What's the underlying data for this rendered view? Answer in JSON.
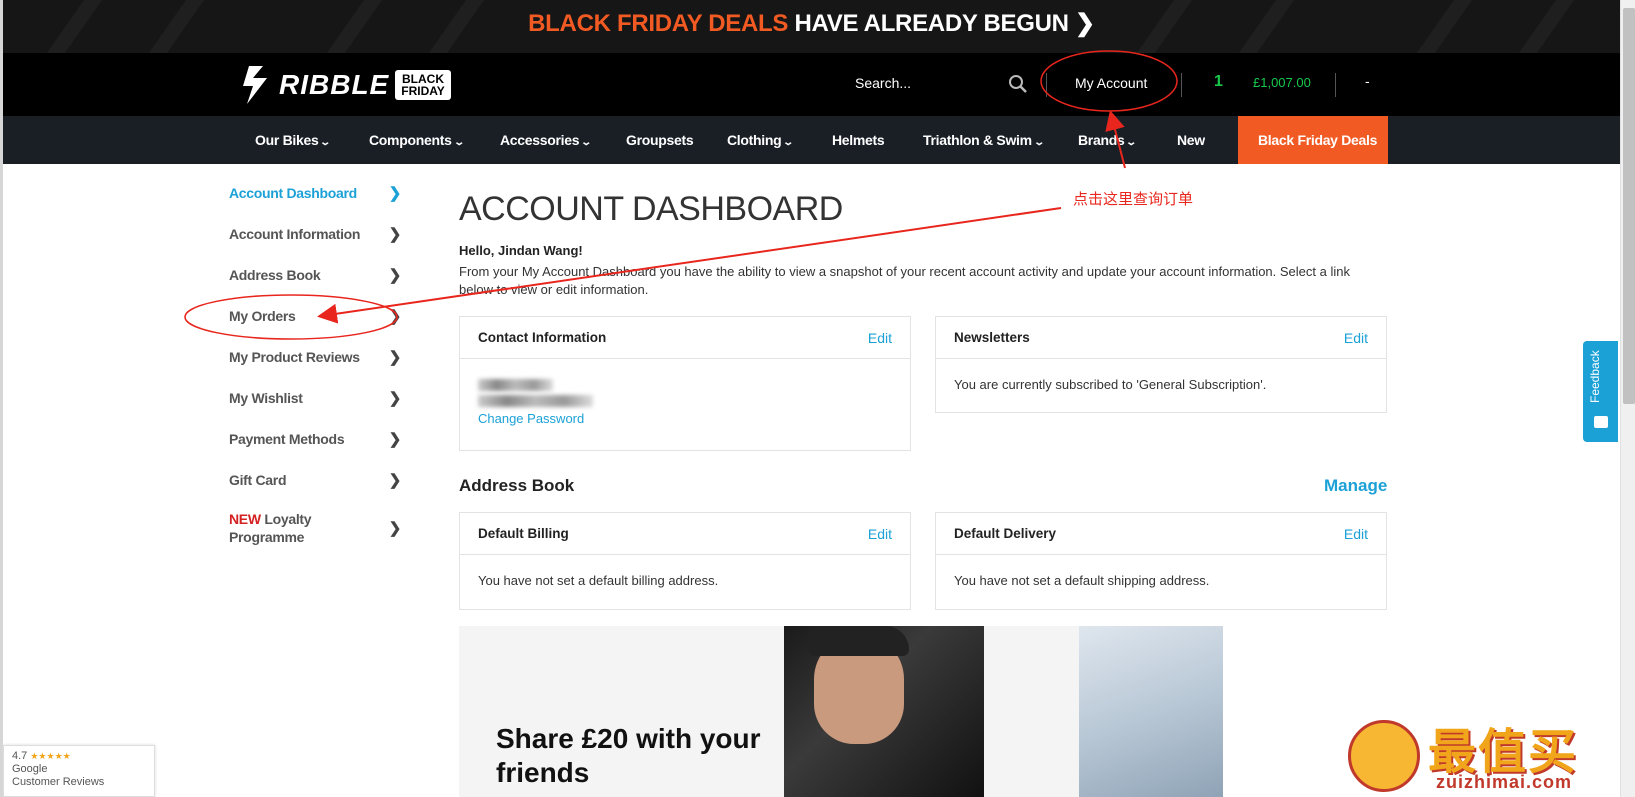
{
  "promo": {
    "highlight": "BLACK FRIDAY DEALS",
    "rest": "HAVE ALREADY BEGUN",
    "chevron": "❯"
  },
  "header": {
    "logo_word": "RIBBLE",
    "logo_tag_1": "BLACK",
    "logo_tag_2": "FRIDAY",
    "search_placeholder": "Search...",
    "search_icon": "search-icon",
    "my_account": "My Account",
    "cart_count": "1",
    "cart_total": "£1,007.00",
    "dash": "-"
  },
  "nav": {
    "items": [
      "Our Bikes",
      "Components",
      "Accessories",
      "Groupsets",
      "Clothing",
      "Helmets",
      "Triathlon & Swim",
      "Brands",
      "New",
      "Black Friday Deals"
    ],
    "chevron": "⌄"
  },
  "sidebar": {
    "items": [
      {
        "label": "Account Dashboard"
      },
      {
        "label": "Account Information"
      },
      {
        "label": "Address Book"
      },
      {
        "label": "My Orders"
      },
      {
        "label": "My Product Reviews"
      },
      {
        "label": "My Wishlist"
      },
      {
        "label": "Payment Methods"
      },
      {
        "label": "Gift Card"
      },
      {
        "label_new": "NEW",
        "label": "Loyalty Programme"
      }
    ],
    "arrow": "❯"
  },
  "main": {
    "title": "ACCOUNT DASHBOARD",
    "hello": "Hello, Jindan Wang!",
    "intro": "From your My Account Dashboard you have the ability to view a snapshot of your recent account activity and update your account information. Select a link below to view or edit information.",
    "contact": {
      "title": "Contact Information",
      "edit": "Edit",
      "change_password": "Change Password"
    },
    "newsletters": {
      "title": "Newsletters",
      "edit": "Edit",
      "text": "You are currently subscribed to 'General Subscription'."
    },
    "address_book": {
      "title": "Address Book",
      "manage": "Manage"
    },
    "billing": {
      "title": "Default Billing",
      "edit": "Edit",
      "text": "You have not set a default billing address."
    },
    "delivery": {
      "title": "Default Delivery",
      "edit": "Edit",
      "text": "You have not set a default shipping address."
    },
    "share": {
      "text": "Share £20 with your friends"
    }
  },
  "feedback": {
    "label": "Feedback"
  },
  "google_badge": {
    "rating": "4.7",
    "stars": "★★★★★",
    "line1": "Google",
    "line2": "Customer Reviews"
  },
  "annotation": {
    "text": "点击这里查询订单"
  },
  "watermark": {
    "title": "最值买",
    "url": "zuizhimai.com"
  },
  "colors": {
    "accent": "#1ca1d6",
    "brand_orange": "#f15a22",
    "cart_green": "#17c84a",
    "annotation_red": "#e8261d"
  }
}
